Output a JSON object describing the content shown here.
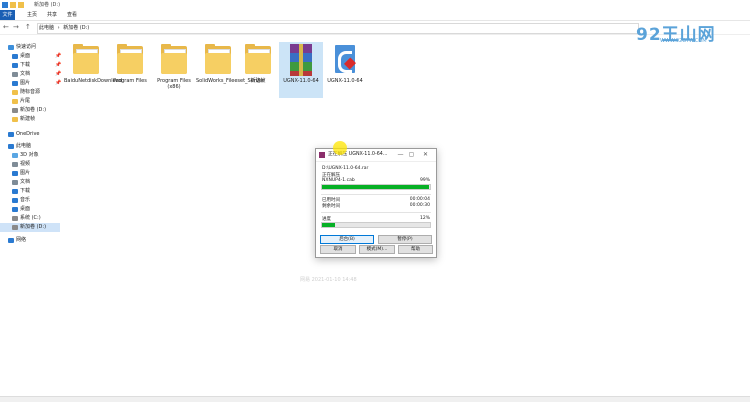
{
  "window": {
    "title": "新加卷 (D:)"
  },
  "ribbon": {
    "tabs": [
      "文件",
      "主页",
      "共享",
      "查看"
    ]
  },
  "address": {
    "back": "←",
    "forward": "→",
    "up": "↑",
    "crumbs": [
      "此电脑",
      "›",
      "新加卷 (D:)"
    ]
  },
  "sidebar": {
    "items": [
      {
        "label": "快速访问",
        "color": "#3d8fdb"
      },
      {
        "label": "桌面",
        "color": "#2a7ad1"
      },
      {
        "label": "下载",
        "color": "#2a7ad1"
      },
      {
        "label": "文档",
        "color": "#7f8c97"
      },
      {
        "label": "图片",
        "color": "#2a7ad1"
      },
      {
        "label": "随标音源",
        "color": "#f0c04a"
      },
      {
        "label": "片尾",
        "color": "#f0c04a"
      },
      {
        "label": "新加卷 (D:)",
        "color": "#8a8a8a"
      },
      {
        "label": "新建帧",
        "color": "#f0c04a"
      },
      {
        "label": "OneDrive",
        "color": "#2a7ad1"
      },
      {
        "label": "此电脑",
        "color": "#2a7ad1"
      },
      {
        "label": "3D 对象",
        "color": "#5aa6e3"
      },
      {
        "label": "视频",
        "color": "#7f8c97"
      },
      {
        "label": "图片",
        "color": "#2a7ad1"
      },
      {
        "label": "文档",
        "color": "#7f8c97"
      },
      {
        "label": "下载",
        "color": "#2a7ad1"
      },
      {
        "label": "音乐",
        "color": "#2a7ad1"
      },
      {
        "label": "桌面",
        "color": "#2a7ad1"
      },
      {
        "label": "系统 (C:)",
        "color": "#8a8a8a"
      },
      {
        "label": "新加卷 (D:)",
        "color": "#8a8a8a"
      },
      {
        "label": "网络",
        "color": "#2a7ad1"
      }
    ],
    "pin": "📌"
  },
  "files": [
    {
      "label": "BaiduNetdiskDownload",
      "kind": "folder"
    },
    {
      "label": "Program Files",
      "kind": "folder"
    },
    {
      "label": "Program Files (x86)",
      "kind": "folder"
    },
    {
      "label": "SolidWorks_Fileeset_Server",
      "kind": "folder"
    },
    {
      "label": "新建帧",
      "kind": "folder"
    },
    {
      "label": "UGNX-11.0-64",
      "kind": "rar"
    },
    {
      "label": "UGNX-11.0-64",
      "kind": "exe"
    }
  ],
  "dialog": {
    "title": "正在解压 UGNX-11.0-64...",
    "path": "D:\\UGNX-11.0-64.rar",
    "action": "正在解压",
    "filename": "NXNUP4-1.cab",
    "file_percent": "99%",
    "file_progress": 0.99,
    "elapsed_label": "已用时间",
    "elapsed_value": "00:00:04",
    "remaining_label": "剩余时间",
    "remaining_value": "00:00:30",
    "progress_label": "进度",
    "progress_percent": "12%",
    "total_progress": 0.12,
    "buttons": {
      "background": "后台(B)",
      "pause": "暂停(P)",
      "cancel": "取消",
      "mode": "模式(M)...",
      "help": "帮助"
    },
    "win": {
      "min": "—",
      "max": "▢",
      "close": "✕"
    }
  },
  "watermark": {
    "text": "网易 2021-01-10 14:48"
  },
  "brand": {
    "logo": "92王山网",
    "url": "WWW.92GYW.COM"
  }
}
